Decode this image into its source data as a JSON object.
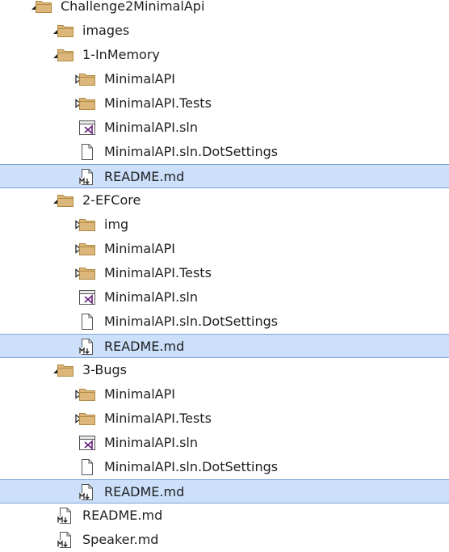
{
  "colors": {
    "folder_fill": "#dcb67a",
    "folder_stroke": "#b08a40",
    "selection_bg": "#cce0fb",
    "selection_border": "#7fa4d6",
    "vs_purple": "#68217a",
    "text": "#1e1e1e"
  },
  "tree": [
    {
      "label": "Challenge2MinimalApi",
      "type": "folder",
      "icon": "folder-icon",
      "depth": 0,
      "expander": "expanded",
      "selected": false
    },
    {
      "label": "images",
      "type": "folder",
      "icon": "folder-icon",
      "depth": 1,
      "expander": "expanded",
      "selected": false
    },
    {
      "label": "1-InMemory",
      "type": "folder",
      "icon": "folder-icon",
      "depth": 1,
      "expander": "expanded",
      "selected": false
    },
    {
      "label": "MinimalAPI",
      "type": "folder",
      "icon": "folder-icon",
      "depth": 2,
      "expander": "collapsed",
      "selected": false
    },
    {
      "label": "MinimalAPI.Tests",
      "type": "folder",
      "icon": "folder-icon",
      "depth": 2,
      "expander": "collapsed",
      "selected": false
    },
    {
      "label": "MinimalAPI.sln",
      "type": "sln",
      "icon": "visual-studio-solution-icon",
      "depth": 2,
      "expander": "none",
      "selected": false
    },
    {
      "label": "MinimalAPI.sln.DotSettings",
      "type": "file",
      "icon": "file-icon",
      "depth": 2,
      "expander": "none",
      "selected": false
    },
    {
      "label": "README.md",
      "type": "md",
      "icon": "markdown-file-icon",
      "depth": 2,
      "expander": "none",
      "selected": true
    },
    {
      "label": "2-EFCore",
      "type": "folder",
      "icon": "folder-icon",
      "depth": 1,
      "expander": "expanded",
      "selected": false
    },
    {
      "label": "img",
      "type": "folder",
      "icon": "folder-icon",
      "depth": 2,
      "expander": "collapsed",
      "selected": false
    },
    {
      "label": "MinimalAPI",
      "type": "folder",
      "icon": "folder-icon",
      "depth": 2,
      "expander": "collapsed",
      "selected": false
    },
    {
      "label": "MinimalAPI.Tests",
      "type": "folder",
      "icon": "folder-icon",
      "depth": 2,
      "expander": "collapsed",
      "selected": false
    },
    {
      "label": "MinimalAPI.sln",
      "type": "sln",
      "icon": "visual-studio-solution-icon",
      "depth": 2,
      "expander": "none",
      "selected": false
    },
    {
      "label": "MinimalAPI.sln.DotSettings",
      "type": "file",
      "icon": "file-icon",
      "depth": 2,
      "expander": "none",
      "selected": false
    },
    {
      "label": "README.md",
      "type": "md",
      "icon": "markdown-file-icon",
      "depth": 2,
      "expander": "none",
      "selected": true
    },
    {
      "label": "3-Bugs",
      "type": "folder",
      "icon": "folder-icon",
      "depth": 1,
      "expander": "expanded",
      "selected": false
    },
    {
      "label": "MinimalAPI",
      "type": "folder",
      "icon": "folder-icon",
      "depth": 2,
      "expander": "collapsed",
      "selected": false
    },
    {
      "label": "MinimalAPI.Tests",
      "type": "folder",
      "icon": "folder-icon",
      "depth": 2,
      "expander": "collapsed",
      "selected": false
    },
    {
      "label": "MinimalAPI.sln",
      "type": "sln",
      "icon": "visual-studio-solution-icon",
      "depth": 2,
      "expander": "none",
      "selected": false
    },
    {
      "label": "MinimalAPI.sln.DotSettings",
      "type": "file",
      "icon": "file-icon",
      "depth": 2,
      "expander": "none",
      "selected": false
    },
    {
      "label": "README.md",
      "type": "md",
      "icon": "markdown-file-icon",
      "depth": 2,
      "expander": "none",
      "selected": true
    },
    {
      "label": "README.md",
      "type": "md",
      "icon": "markdown-file-icon",
      "depth": 1,
      "expander": "none",
      "selected": false
    },
    {
      "label": "Speaker.md",
      "type": "md",
      "icon": "markdown-file-icon",
      "depth": 1,
      "expander": "none",
      "selected": false
    }
  ]
}
